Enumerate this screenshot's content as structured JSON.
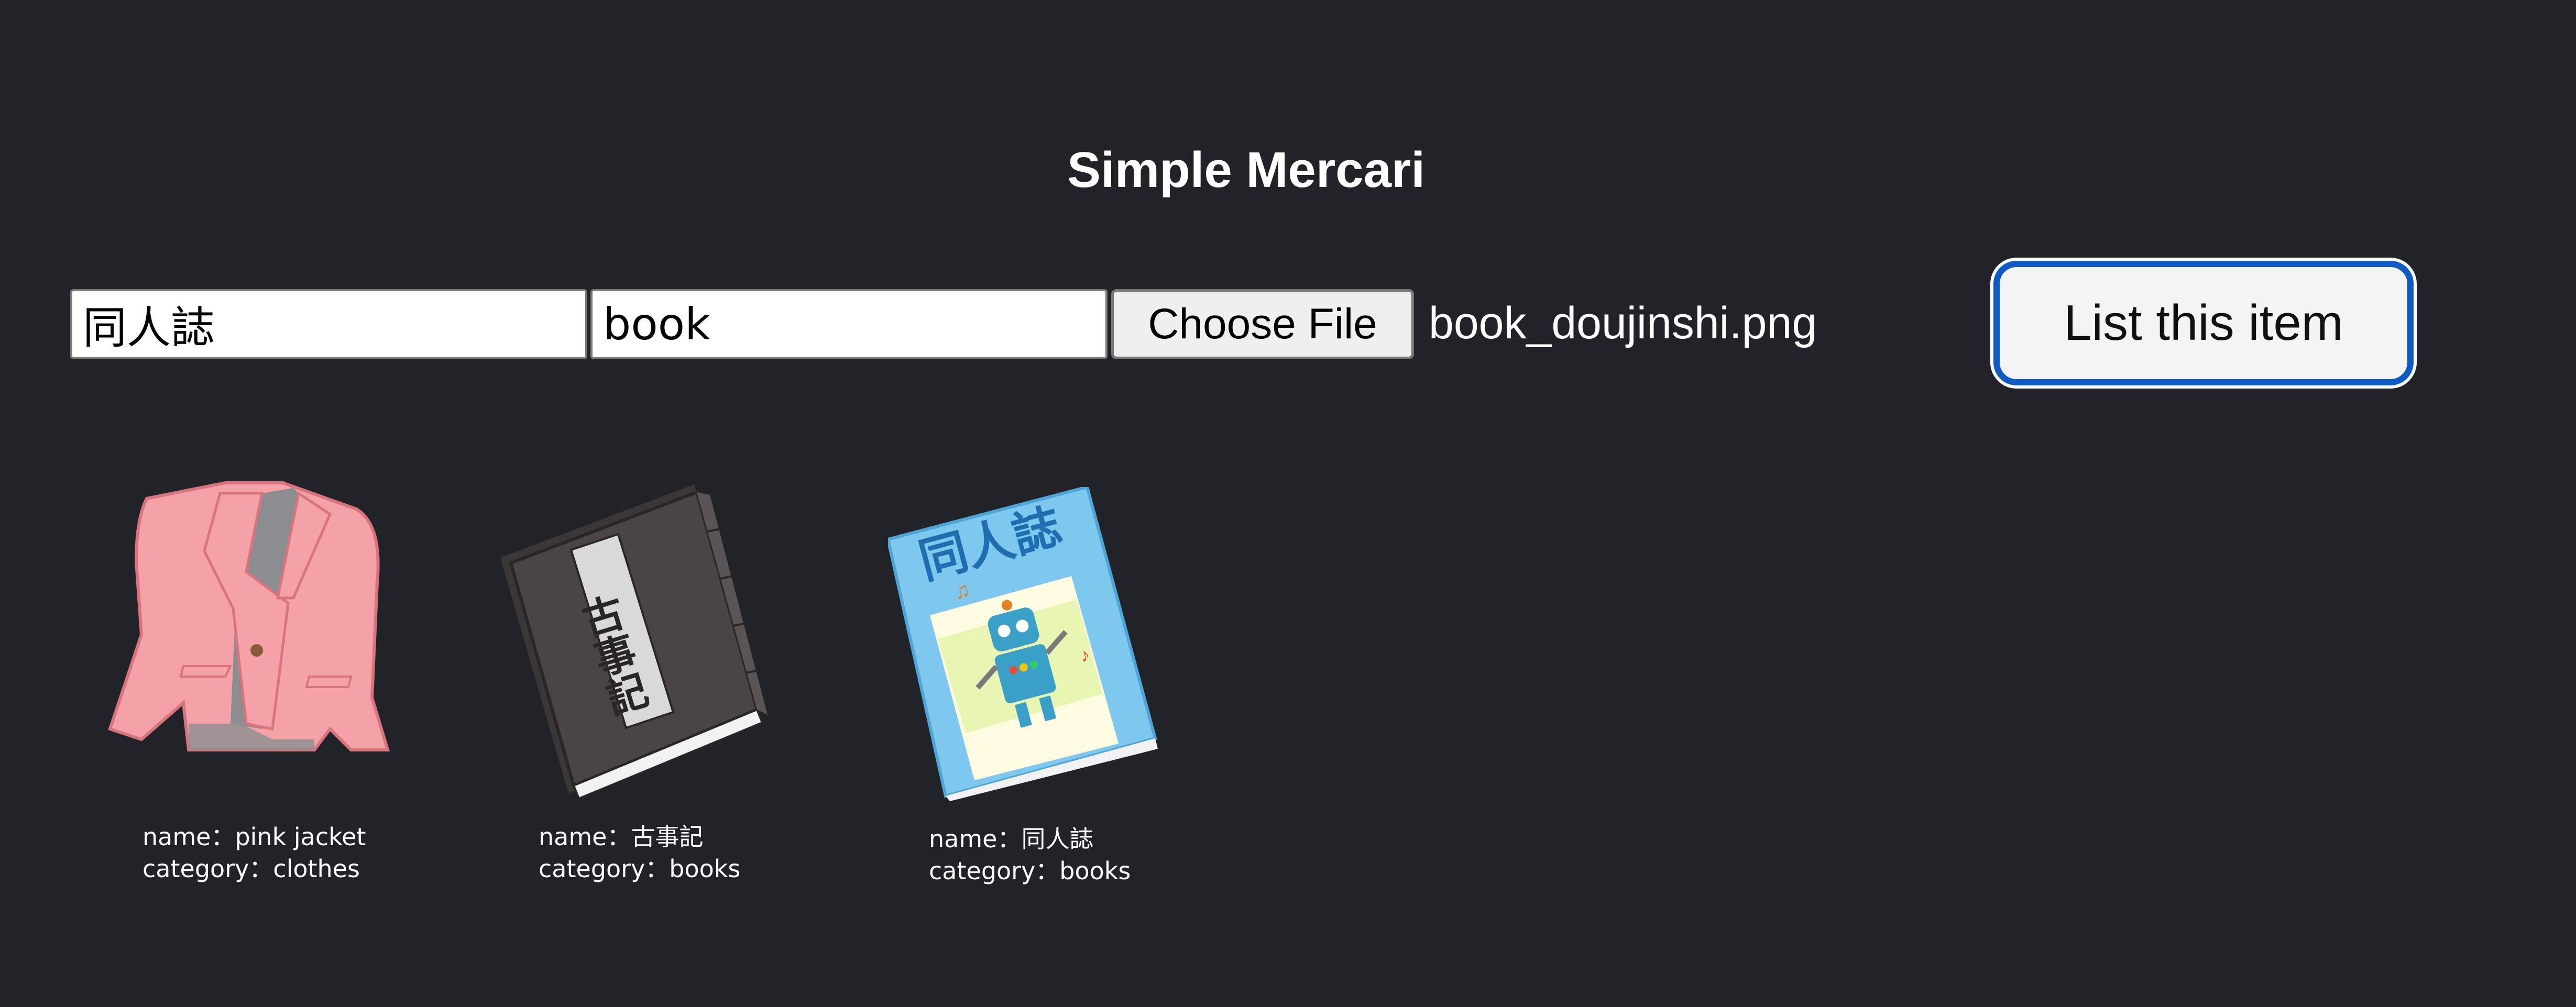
{
  "header": {
    "title": "Simple Mercari"
  },
  "form": {
    "name_value": "同人誌",
    "category_value": "book",
    "file_button_label": "Choose File",
    "file_name": "book_doujinshi.png",
    "submit_label": "List this item"
  },
  "items": [
    {
      "name_line": "name：pink jacket",
      "category_line": "category：clothes",
      "image": "pink-jacket-icon"
    },
    {
      "name_line": "name：古事記",
      "category_line": "category：books",
      "image": "kojiki-book-icon"
    },
    {
      "name_line": "name：同人誌",
      "category_line": "category：books",
      "image": "doujinshi-book-icon"
    }
  ],
  "illustrations": {
    "kojiki_cover_text": "古事記",
    "doujinshi_cover_text": "同人誌"
  },
  "colors": {
    "background": "#212328",
    "accent_border": "#0f5bc6",
    "jacket": "#f4a2a8",
    "kojiki_cover": "#4a4446",
    "doujinshi_cover": "#7ec8ef"
  }
}
